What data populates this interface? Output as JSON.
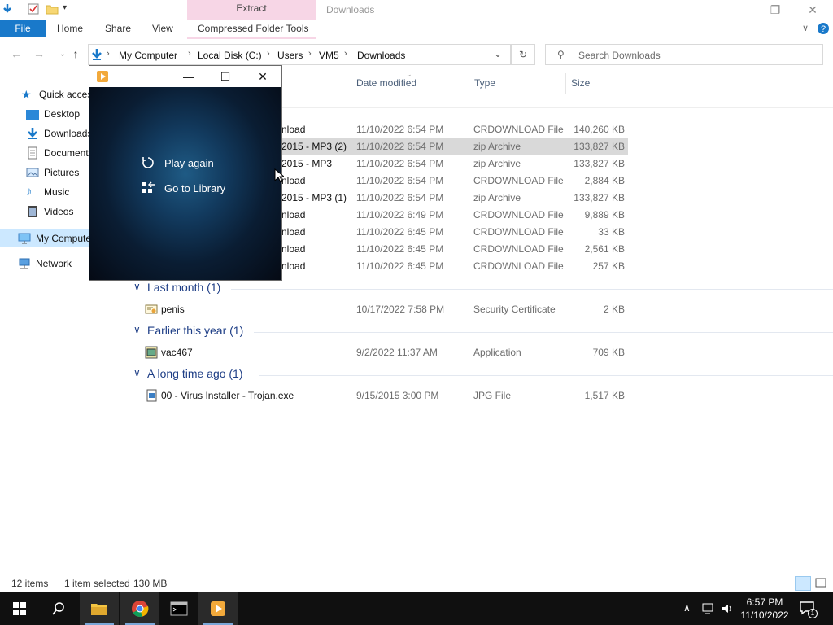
{
  "window": {
    "title": "Downloads",
    "context_tab_group": "Extract"
  },
  "ribbon": {
    "tabs": [
      "File",
      "Home",
      "Share",
      "View",
      "Compressed Folder Tools"
    ]
  },
  "address": {
    "crumbs": [
      "My Computer",
      "Local Disk (C:)",
      "Users",
      "VM5",
      "Downloads"
    ],
    "search_placeholder": "Search Downloads"
  },
  "nav": {
    "items": [
      "Quick access",
      "Desktop",
      "Downloads",
      "Documents",
      "Pictures",
      "Music",
      "Videos",
      "My Computer",
      "Network"
    ]
  },
  "columns": {
    "date": "Date modified",
    "type": "Type",
    "size": "Size"
  },
  "files_today": [
    {
      "name": "nload",
      "date": "11/10/2022 6:54 PM",
      "type": "CRDOWNLOAD File",
      "size": "140,260 KB"
    },
    {
      "name": "2015 - MP3 (2)",
      "date": "11/10/2022 6:54 PM",
      "type": "zip Archive",
      "size": "133,827 KB"
    },
    {
      "name": "2015 - MP3",
      "date": "11/10/2022 6:54 PM",
      "type": "zip Archive",
      "size": "133,827 KB"
    },
    {
      "name": "nload",
      "date": "11/10/2022 6:54 PM",
      "type": "CRDOWNLOAD File",
      "size": "2,884 KB"
    },
    {
      "name": "2015 - MP3 (1)",
      "date": "11/10/2022 6:54 PM",
      "type": "zip Archive",
      "size": "133,827 KB"
    },
    {
      "name": "nload",
      "date": "11/10/2022 6:49 PM",
      "type": "CRDOWNLOAD File",
      "size": "9,889 KB"
    },
    {
      "name": "nload",
      "date": "11/10/2022 6:45 PM",
      "type": "CRDOWNLOAD File",
      "size": "33 KB"
    },
    {
      "name": "nload",
      "date": "11/10/2022 6:45 PM",
      "type": "CRDOWNLOAD File",
      "size": "2,561 KB"
    },
    {
      "name": "nload",
      "date": "11/10/2022 6:45 PM",
      "type": "CRDOWNLOAD File",
      "size": "257 KB"
    }
  ],
  "groups": [
    {
      "label": "Last month (1)",
      "file": {
        "name": "penis",
        "date": "10/17/2022 7:58 PM",
        "type": "Security Certificate",
        "size": "2 KB"
      }
    },
    {
      "label": "Earlier this year (1)",
      "file": {
        "name": "vac467",
        "date": "9/2/2022 11:37 AM",
        "type": "Application",
        "size": "709 KB"
      }
    },
    {
      "label": "A long time ago (1)",
      "file": {
        "name": "00 - Virus Installer - Trojan.exe",
        "date": "9/15/2015 3:00 PM",
        "type": "JPG File",
        "size": "1,517 KB"
      }
    }
  ],
  "status": {
    "items": "12 items",
    "selected": "1 item selected",
    "selected_size": "130 MB"
  },
  "player": {
    "play_again": "Play again",
    "go_to_library": "Go to Library"
  },
  "taskbar": {
    "time": "6:57 PM",
    "date": "11/10/2022",
    "notification_count": "1"
  },
  "colors": {
    "accent": "#1979ca",
    "context_tab": "#f7d6e6",
    "group_header": "#1e3e86",
    "selection": "#cce8ff"
  }
}
